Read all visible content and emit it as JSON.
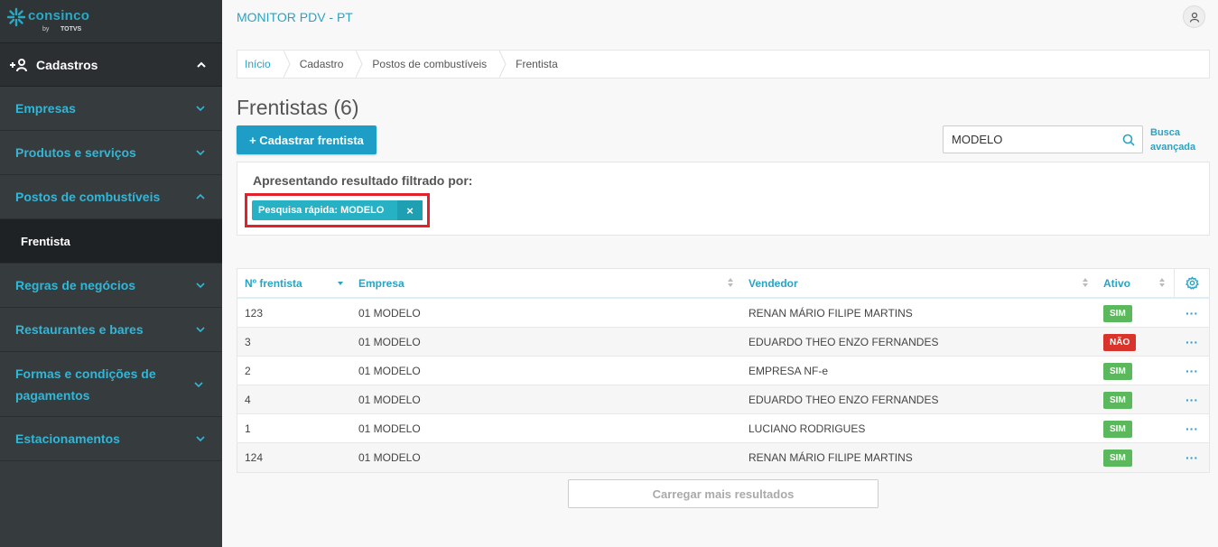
{
  "brand": {
    "name": "consinco",
    "by": "by",
    "partner": "TOTVS"
  },
  "app_title": "MONITOR PDV - PT",
  "sidebar": {
    "header": "Cadastros",
    "items": [
      {
        "label": "Empresas"
      },
      {
        "label": "Produtos e serviços"
      },
      {
        "label": "Postos de combustíveis"
      },
      {
        "label": "Frentista"
      },
      {
        "label": "Regras de negócios"
      },
      {
        "label": "Restaurantes e bares"
      },
      {
        "label": "Formas e condições de pagamentos"
      },
      {
        "label": "Estacionamentos"
      }
    ]
  },
  "breadcrumb": [
    "Início",
    "Cadastro",
    "Postos de combustíveis",
    "Frentista"
  ],
  "page_title": "Frentistas (6)",
  "add_button": "+ Cadastrar frentista",
  "search": {
    "value": "MODELO"
  },
  "advanced_search": "Busca avançada",
  "filter": {
    "title": "Apresentando resultado filtrado por:",
    "chip": "Pesquisa rápida: MODELO",
    "chip_close": "×"
  },
  "table": {
    "headers": [
      "Nº frentista",
      "Empresa",
      "Vendedor",
      "Ativo"
    ],
    "rows": [
      {
        "num": "123",
        "empresa": "01 MODELO",
        "vendedor": "RENAN MÁRIO FILIPE MARTINS",
        "ativo": "SIM"
      },
      {
        "num": "3",
        "empresa": "01 MODELO",
        "vendedor": "EDUARDO THEO ENZO FERNANDES",
        "ativo": "NÃO"
      },
      {
        "num": "2",
        "empresa": "01 MODELO",
        "vendedor": "EMPRESA NF-e",
        "ativo": "SIM"
      },
      {
        "num": "4",
        "empresa": "01 MODELO",
        "vendedor": "EDUARDO THEO ENZO FERNANDES",
        "ativo": "SIM"
      },
      {
        "num": "1",
        "empresa": "01 MODELO",
        "vendedor": "LUCIANO RODRIGUES",
        "ativo": "SIM"
      },
      {
        "num": "124",
        "empresa": "01 MODELO",
        "vendedor": "RENAN MÁRIO FILIPE MARTINS",
        "ativo": "SIM"
      }
    ],
    "row_action": "···"
  },
  "load_more": "Carregar mais resultados",
  "colors": {
    "accent": "#2aa3c3",
    "sidebar": "#363b3e",
    "active": "#5cb85c",
    "inactive": "#d9342b"
  }
}
